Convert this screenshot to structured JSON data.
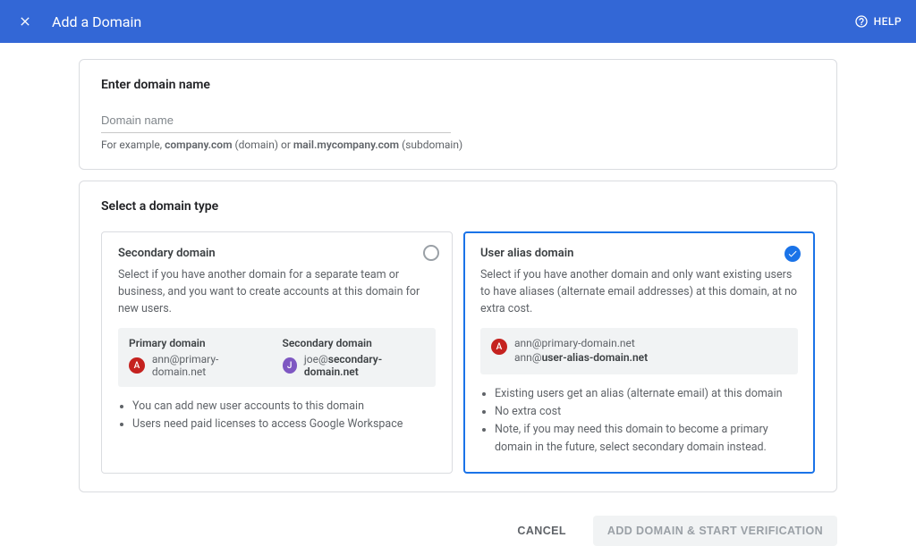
{
  "header": {
    "title": "Add a Domain",
    "help": "HELP"
  },
  "section_enter": {
    "heading": "Enter domain name",
    "placeholder": "Domain name",
    "hint_prefix": "For example, ",
    "hint_bold1": "company.com",
    "hint_mid": " (domain) or ",
    "hint_bold2": "mail.mycompany.com",
    "hint_suffix": " (subdomain)"
  },
  "section_type": {
    "heading": "Select a domain type",
    "secondary": {
      "title": "Secondary domain",
      "desc": "Select if you have another domain for a separate team or business, and you want to create accounts at this domain for new users.",
      "primary_label": "Primary domain",
      "secondary_label": "Secondary domain",
      "primary_email": "ann@primary-domain.net",
      "secondary_email_prefix": "joe@",
      "secondary_email_bold": "secondary-domain.net",
      "bullets": [
        "You can add new user accounts to this domain",
        "Users need paid licenses to access Google Workspace"
      ]
    },
    "alias": {
      "title": "User alias domain",
      "desc": "Select if you have another domain and only want existing users to have aliases (alternate email addresses) at this domain, at no extra cost.",
      "email1": "ann@primary-domain.net",
      "email2_prefix": "ann@",
      "email2_bold": "user-alias-domain.net",
      "bullets": [
        "Existing users get an alias (alternate email) at this domain",
        "No extra cost",
        "Note, if you may need this domain to become a primary domain in the future, select secondary domain instead."
      ]
    }
  },
  "actions": {
    "cancel": "CANCEL",
    "submit": "ADD DOMAIN & START VERIFICATION"
  },
  "avatar_letters": {
    "a": "A",
    "j": "J"
  }
}
